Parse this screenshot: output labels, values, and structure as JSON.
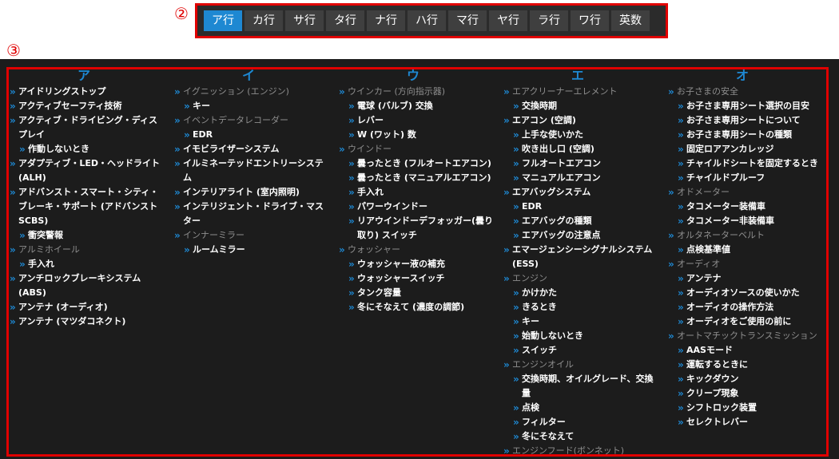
{
  "markers": {
    "tabs": "②",
    "content": "③"
  },
  "tabs": [
    "ア行",
    "カ行",
    "サ行",
    "タ行",
    "ナ行",
    "ハ行",
    "マ行",
    "ヤ行",
    "ラ行",
    "ワ行",
    "英数"
  ],
  "active_tab": 0,
  "columns": [
    {
      "head": "ア",
      "items": [
        {
          "t": "アイドリングストップ",
          "k": "l1"
        },
        {
          "t": "アクティブセーフティ技術",
          "k": "l1"
        },
        {
          "t": "アクティブ・ドライビング・ディスプレイ",
          "k": "l1"
        },
        {
          "t": "作動しないとき",
          "k": "l2"
        },
        {
          "t": "アダプティブ・LED・ヘッドライト(ALH)",
          "k": "l1"
        },
        {
          "t": "アドバンスト・スマート・シティ・ブレーキ・サポート (アドバンストSCBS)",
          "k": "l1"
        },
        {
          "t": "衝突警報",
          "k": "l2"
        },
        {
          "t": "アルミホイール",
          "k": "cat"
        },
        {
          "t": "手入れ",
          "k": "l2"
        },
        {
          "t": "アンチロックブレーキシステム(ABS)",
          "k": "l1"
        },
        {
          "t": "アンテナ (オーディオ)",
          "k": "l1"
        },
        {
          "t": "アンテナ (マツダコネクト)",
          "k": "l1"
        }
      ]
    },
    {
      "head": "イ",
      "items": [
        {
          "t": "イグニッション (エンジン)",
          "k": "cat"
        },
        {
          "t": "キー",
          "k": "l2"
        },
        {
          "t": "イベントデータレコーダー",
          "k": "cat"
        },
        {
          "t": "EDR",
          "k": "l2"
        },
        {
          "t": "イモビライザーシステム",
          "k": "l1"
        },
        {
          "t": "イルミネーテッドエントリーシステム",
          "k": "l1"
        },
        {
          "t": "インテリアライト (室内照明)",
          "k": "l1"
        },
        {
          "t": "インテリジェント・ドライブ・マスター",
          "k": "l1"
        },
        {
          "t": "インナーミラー",
          "k": "cat"
        },
        {
          "t": "ルームミラー",
          "k": "l2"
        }
      ]
    },
    {
      "head": "ウ",
      "items": [
        {
          "t": "ウインカー (方向指示器)",
          "k": "cat"
        },
        {
          "t": "電球 (バルブ) 交換",
          "k": "l2"
        },
        {
          "t": "レバー",
          "k": "l2"
        },
        {
          "t": "W (ワット) 数",
          "k": "l2"
        },
        {
          "t": "ウインドー",
          "k": "cat"
        },
        {
          "t": "曇ったとき (フルオートエアコン)",
          "k": "l2"
        },
        {
          "t": "曇ったとき (マニュアルエアコン)",
          "k": "l2"
        },
        {
          "t": "手入れ",
          "k": "l2"
        },
        {
          "t": "パワーウインドー",
          "k": "l2"
        },
        {
          "t": "リアウインドーデフォッガー(曇り取り) スイッチ",
          "k": "l2"
        },
        {
          "t": "ウォッシャー",
          "k": "cat"
        },
        {
          "t": "ウォッシャー液の補充",
          "k": "l2"
        },
        {
          "t": "ウォッシャースイッチ",
          "k": "l2"
        },
        {
          "t": "タンク容量",
          "k": "l2"
        },
        {
          "t": "冬にそなえて (濃度の調節)",
          "k": "l2"
        }
      ]
    },
    {
      "head": "エ",
      "items": [
        {
          "t": "エアクリーナーエレメント",
          "k": "cat"
        },
        {
          "t": "交換時期",
          "k": "l2"
        },
        {
          "t": "エアコン (空調)",
          "k": "l1"
        },
        {
          "t": "上手な使いかた",
          "k": "l2"
        },
        {
          "t": "吹き出し口 (空調)",
          "k": "l2"
        },
        {
          "t": "フルオートエアコン",
          "k": "l2"
        },
        {
          "t": "マニュアルエアコン",
          "k": "l2"
        },
        {
          "t": "エアバッグシステム",
          "k": "l1"
        },
        {
          "t": "EDR",
          "k": "l2"
        },
        {
          "t": "エアバッグの種類",
          "k": "l2"
        },
        {
          "t": "エアバッグの注意点",
          "k": "l2"
        },
        {
          "t": "エマージェンシーシグナルシステム (ESS)",
          "k": "l1"
        },
        {
          "t": "エンジン",
          "k": "cat"
        },
        {
          "t": "かけかた",
          "k": "l2"
        },
        {
          "t": "きるとき",
          "k": "l2"
        },
        {
          "t": "キー",
          "k": "l2"
        },
        {
          "t": "始動しないとき",
          "k": "l2"
        },
        {
          "t": "スイッチ",
          "k": "l2"
        },
        {
          "t": "エンジンオイル",
          "k": "cat"
        },
        {
          "t": "交換時期、オイルグレード、交換量",
          "k": "l2"
        },
        {
          "t": "点検",
          "k": "l2"
        },
        {
          "t": "フィルター",
          "k": "l2"
        },
        {
          "t": "冬にそなえて",
          "k": "l2"
        },
        {
          "t": "エンジンフード(ボンネット)",
          "k": "cat"
        }
      ]
    },
    {
      "head": "オ",
      "items": [
        {
          "t": "お子さまの安全",
          "k": "cat"
        },
        {
          "t": "お子さま専用シート選択の目安",
          "k": "l2"
        },
        {
          "t": "お子さま専用シートについて",
          "k": "l2"
        },
        {
          "t": "お子さま専用シートの種類",
          "k": "l2"
        },
        {
          "t": "固定ロアアンカレッジ",
          "k": "l2"
        },
        {
          "t": "チャイルドシートを固定するとき",
          "k": "l2"
        },
        {
          "t": "チャイルドプルーフ",
          "k": "l2"
        },
        {
          "t": "オドメーター",
          "k": "cat"
        },
        {
          "t": "タコメーター装備車",
          "k": "l2"
        },
        {
          "t": "タコメーター非装備車",
          "k": "l2"
        },
        {
          "t": "オルタネーターベルト",
          "k": "cat"
        },
        {
          "t": "点検基準値",
          "k": "l2"
        },
        {
          "t": "オーディオ",
          "k": "cat"
        },
        {
          "t": "アンテナ",
          "k": "l2"
        },
        {
          "t": "オーディオソースの使いかた",
          "k": "l2"
        },
        {
          "t": "オーディオの操作方法",
          "k": "l2"
        },
        {
          "t": "オーディオをご使用の前に",
          "k": "l2"
        },
        {
          "t": "オートマチックトランスミッション",
          "k": "cat"
        },
        {
          "t": "AASモード",
          "k": "l2"
        },
        {
          "t": "運転するときに",
          "k": "l2"
        },
        {
          "t": "キックダウン",
          "k": "l2"
        },
        {
          "t": "クリープ現象",
          "k": "l2"
        },
        {
          "t": "シフトロック装置",
          "k": "l2"
        },
        {
          "t": "セレクトレバー",
          "k": "l2"
        }
      ]
    }
  ],
  "colors": {
    "accent": "#1e88d2",
    "highlight_frame": "#e00000",
    "panel_bg": "#1c1c1c",
    "category_text": "#8e8e8e"
  }
}
